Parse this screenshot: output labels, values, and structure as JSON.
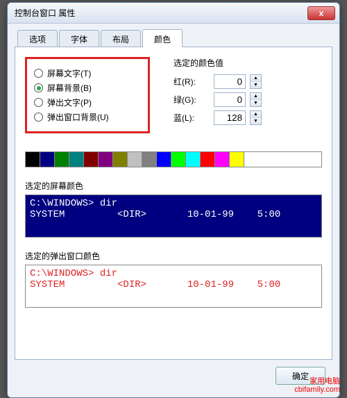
{
  "window": {
    "title": "控制台窗口 属性",
    "close": "x"
  },
  "tabs": {
    "options": "选项",
    "font": "字体",
    "layout": "布局",
    "colors": "颜色",
    "active": "颜色"
  },
  "radios": {
    "screen_text": "屏幕文字(T)",
    "screen_background": "屏幕背景(B)",
    "popup_text": "弹出文字(P)",
    "popup_background": "弹出窗口背景(U)",
    "selected": "screen_background"
  },
  "rgb": {
    "group_title": "选定的颜色值",
    "r_label": "红(R):",
    "g_label": "绿(G):",
    "b_label": "蓝(L):",
    "r_value": "0",
    "g_value": "0",
    "b_value": "128"
  },
  "palette": [
    "#000000",
    "#000080",
    "#008000",
    "#008080",
    "#800000",
    "#800080",
    "#808000",
    "#c0c0c0",
    "#808080",
    "#0000ff",
    "#00ff00",
    "#00ffff",
    "#ff0000",
    "#ff00ff",
    "#ffff00",
    "#ffffff"
  ],
  "screen_preview": {
    "label": "选定的屏幕颜色",
    "line1": "C:\\WINDOWS> dir",
    "line2": "SYSTEM         <DIR>       10-01-99    5:00"
  },
  "popup_preview": {
    "label": "选定的弹出窗口颜色",
    "line1": "C:\\WINDOWS> dir",
    "line2": "SYSTEM         <DIR>       10-01-99    5:00"
  },
  "buttons": {
    "ok": "确定"
  },
  "watermark": {
    "l1": "家用电脑",
    "l2": "cbifamily.com"
  }
}
